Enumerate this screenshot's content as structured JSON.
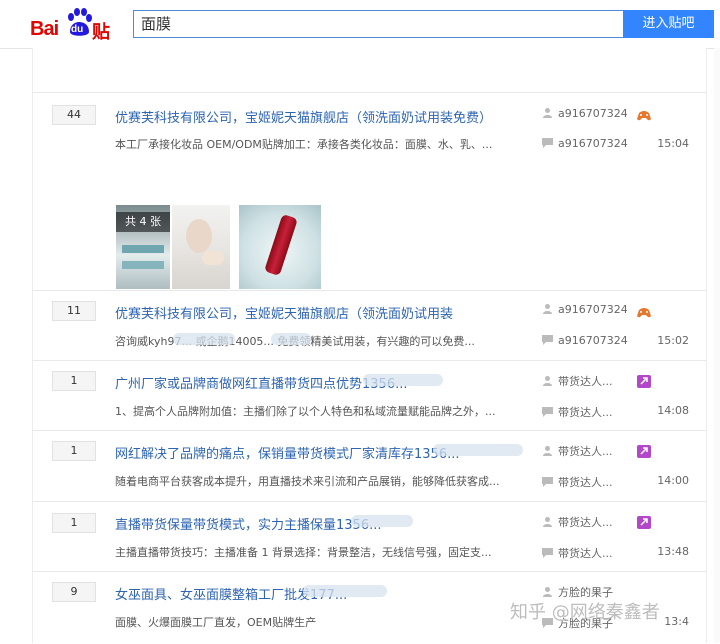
{
  "logo": {
    "text_bai": "Bai",
    "text_du": "du",
    "text_tieba": "贴吧"
  },
  "search": {
    "value": "面膜",
    "button": "进入贴吧"
  },
  "threads": [
    {
      "reply_count": "44",
      "title": "优赛芙科技有限公司，宝姬妮天猫旗舰店（领洗面奶试用装免费）",
      "abstract": "本工厂承接化妆品 OEM/ODM贴牌加工：承接各类化妆品：面膜、水、乳、...",
      "author": "a916707324",
      "last_reply": "a916707324",
      "time": "15:04",
      "image_count_label": "共 4 张"
    },
    {
      "reply_count": "11",
      "title": "优赛芙科技有限公司，宝姬妮天猫旗舰店（领洗面奶试用装",
      "abstract": "咨询威kyh97... 或企鹅14005... 免费领精美试用装，有兴趣的可以免费...",
      "author": "a916707324",
      "last_reply": "a916707324",
      "time": "15:02"
    },
    {
      "reply_count": "1",
      "title": "广州厂家或品牌商做网红直播带货四点优势1356...",
      "abstract": "1、提高个人品牌附加值：主播们除了以个人特色和私域流量赋能品牌之外，...",
      "author": "带货达人...",
      "last_reply": "带货达人...",
      "time": "14:08"
    },
    {
      "reply_count": "1",
      "title": "网红解决了品牌的痛点，保销量带货模式厂家清库存1356...",
      "abstract": "随着电商平台获客成本提升，用直播技术来引流和产品展销，能够降低获客成...",
      "author": "带货达人...",
      "last_reply": "带货达人...",
      "time": "14:00"
    },
    {
      "reply_count": "1",
      "title": "直播带货保量带货模式，实力主播保量1356...",
      "abstract": "主播直播带货技巧：主播准备 1 背景选择：背景整洁，无线信号强，固定支...",
      "author": "带货达人...",
      "last_reply": "带货达人...",
      "time": "13:48"
    },
    {
      "reply_count": "9",
      "title": "女巫面具、女巫面膜整箱工厂批发177...",
      "abstract": "面膜、火爆面膜工厂直发，OEM贴牌生产",
      "author": "方脸的果子",
      "last_reply": "方脸的果子",
      "time": "13:4"
    }
  ],
  "watermark": "知乎 @网络秦鑫者",
  "colors": {
    "brand_red": "#e10602",
    "brand_blue": "#2319dc",
    "link_blue": "#2d64b3",
    "button_blue": "#3385ff"
  },
  "icons": {
    "author": "user-icon",
    "reply": "comment-icon",
    "badge_a": "game-controller-icon",
    "badge_b": "arrow-badge-icon"
  }
}
